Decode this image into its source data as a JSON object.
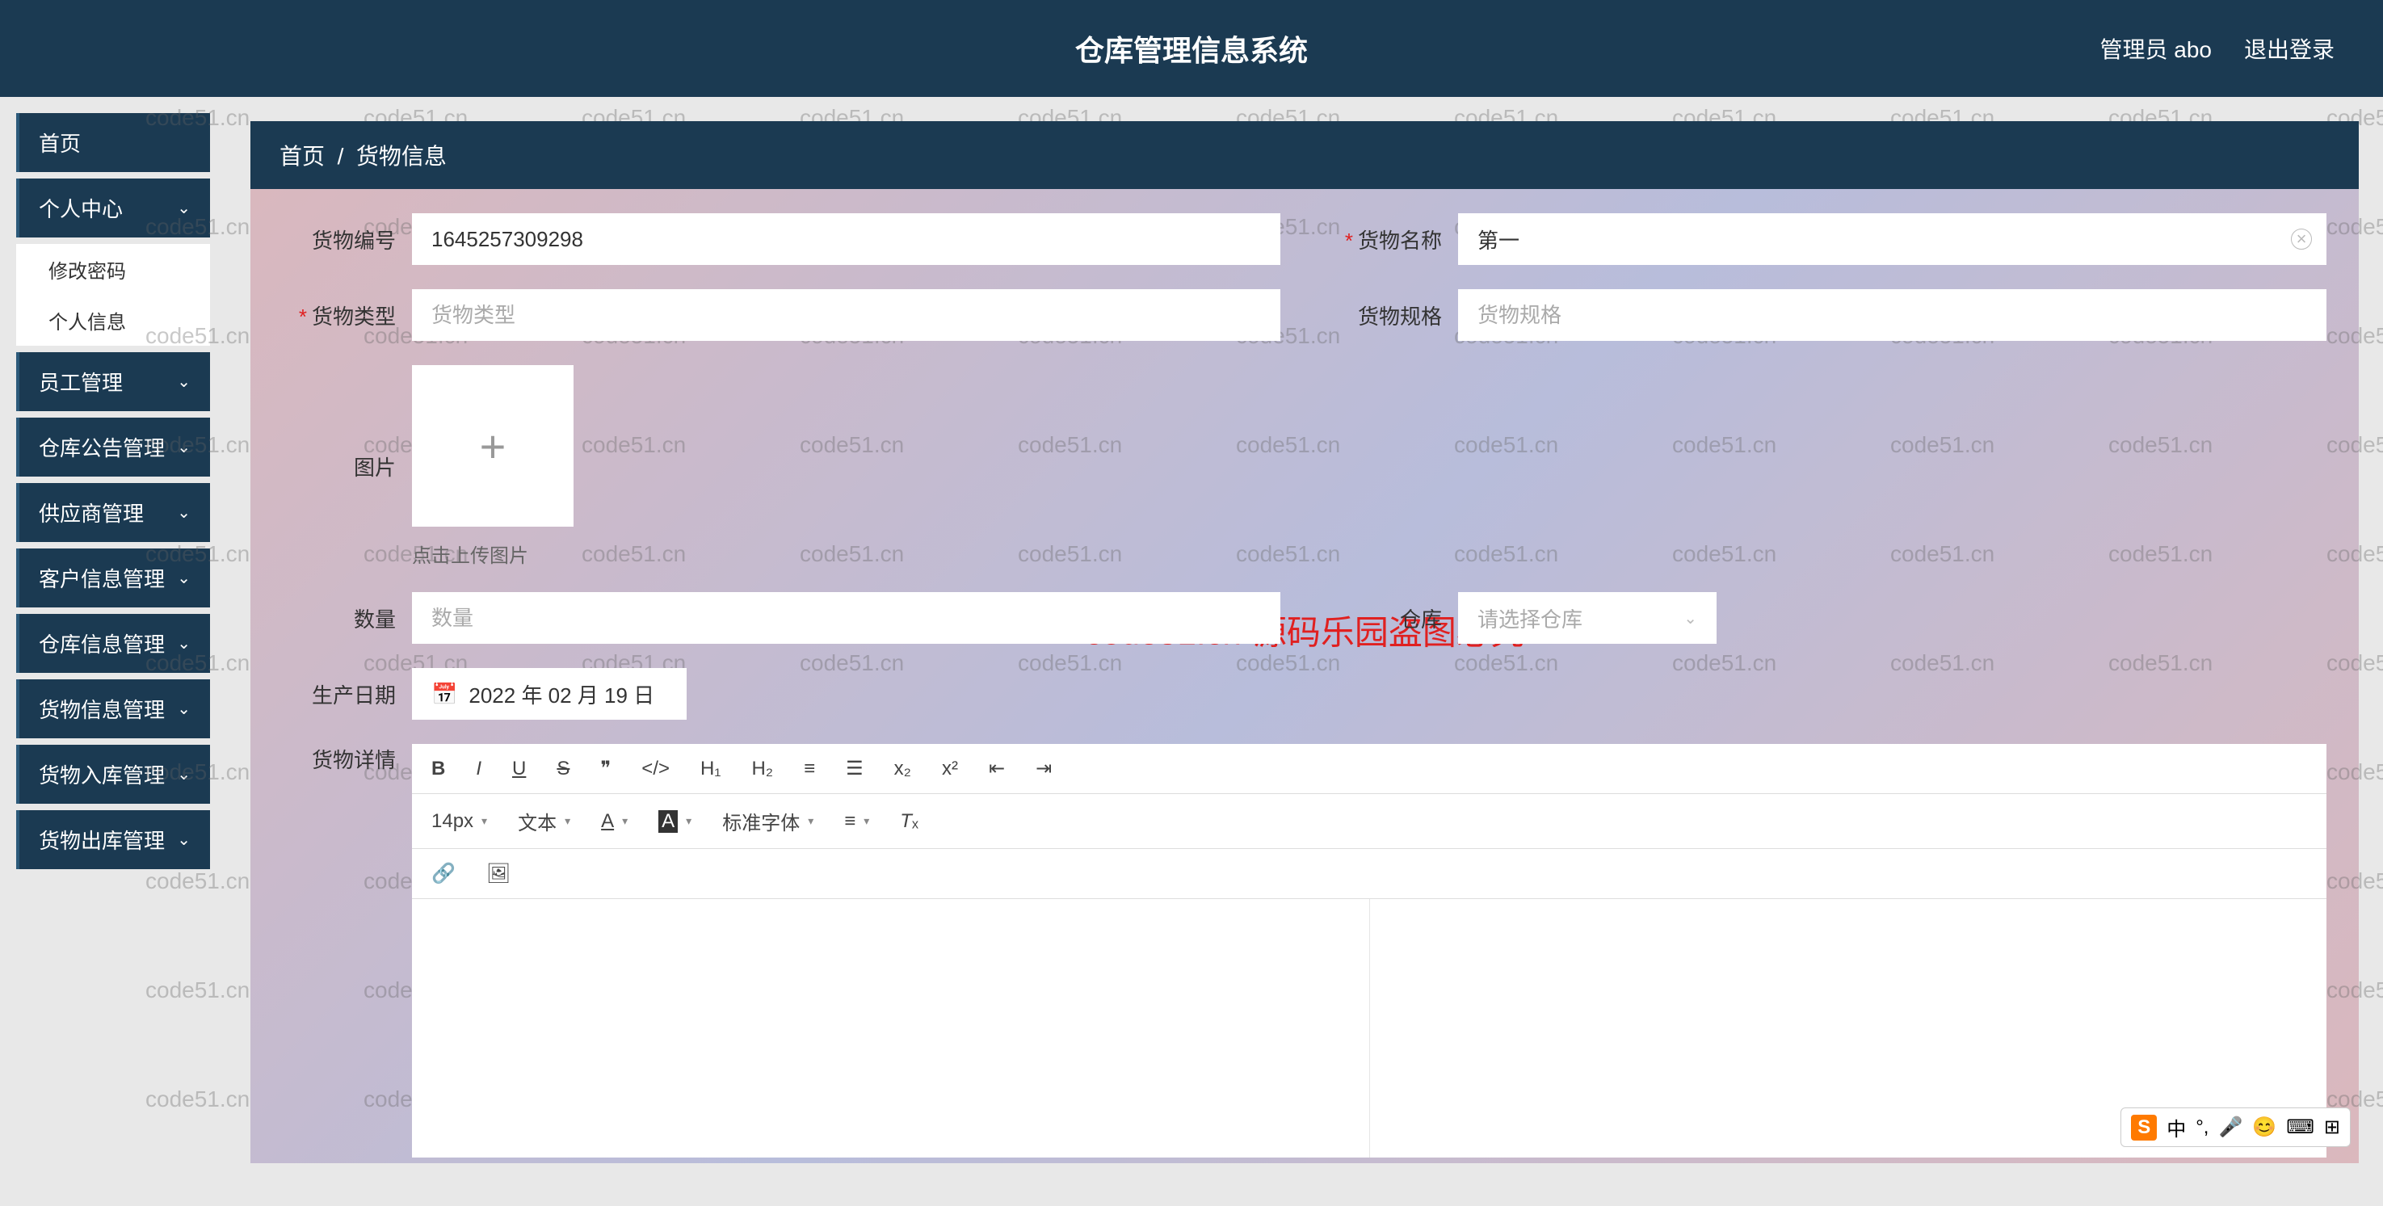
{
  "header": {
    "title": "仓库管理信息系统",
    "user": "管理员 abo",
    "logout": "退出登录"
  },
  "sidebar": {
    "items": [
      {
        "label": "首页",
        "expandable": false
      },
      {
        "label": "个人中心",
        "expandable": true,
        "open": true,
        "children": [
          "修改密码",
          "个人信息"
        ]
      },
      {
        "label": "员工管理",
        "expandable": true
      },
      {
        "label": "仓库公告管理",
        "expandable": true
      },
      {
        "label": "供应商管理",
        "expandable": true
      },
      {
        "label": "客户信息管理",
        "expandable": true
      },
      {
        "label": "仓库信息管理",
        "expandable": true
      },
      {
        "label": "货物信息管理",
        "expandable": true
      },
      {
        "label": "货物入库管理",
        "expandable": true
      },
      {
        "label": "货物出库管理",
        "expandable": true
      }
    ]
  },
  "breadcrumb": {
    "home": "首页",
    "sep": "/",
    "current": "货物信息"
  },
  "form": {
    "code_label": "货物编号",
    "code_value": "1645257309298",
    "name_label": "货物名称",
    "name_value": "第一",
    "type_label": "货物类型",
    "type_placeholder": "货物类型",
    "spec_label": "货物规格",
    "spec_placeholder": "货物规格",
    "image_label": "图片",
    "image_hint": "点击上传图片",
    "qty_label": "数量",
    "qty_placeholder": "数量",
    "warehouse_label": "仓库",
    "warehouse_placeholder": "请选择仓库",
    "date_label": "生产日期",
    "date_value": "2022 年 02 月 19 日",
    "detail_label": "货物详情"
  },
  "editor_toolbar": {
    "font_size": "14px",
    "text_mode": "文本",
    "font_family": "标准字体"
  },
  "watermark": {
    "text": "code51.cn",
    "center": "code51.cn-源码乐园盗图必究"
  },
  "ime": {
    "logo": "S",
    "lang": "中"
  }
}
